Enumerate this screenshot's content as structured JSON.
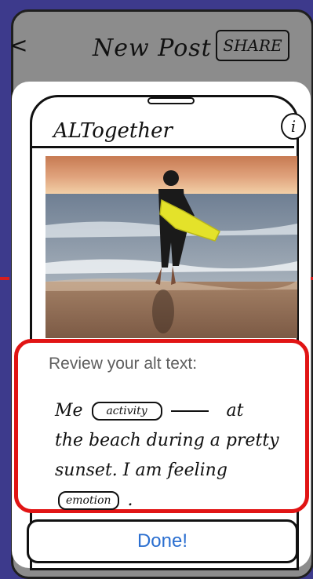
{
  "background_screen": {
    "back_label": "<",
    "title": "New Post",
    "share_label": "SHARE"
  },
  "modal": {
    "app_title": "ALTogether",
    "info_label": "i",
    "image_description": "Person in wetsuit carrying a yellow surfboard walking into the ocean at sunset",
    "review_label": "Review your alt text:",
    "alt_text": {
      "line1_start": "Me",
      "activity_placeholder": "activity",
      "line1_end": "at",
      "line2": "the beach during a pretty",
      "line3": "sunset. I am feeling",
      "emotion_placeholder": "emotion",
      "line4_end": "."
    },
    "done_label": "Done!"
  },
  "colors": {
    "page_background": "#3d3a8c",
    "highlight_red": "#e11414",
    "done_blue": "#2b6fd0"
  }
}
